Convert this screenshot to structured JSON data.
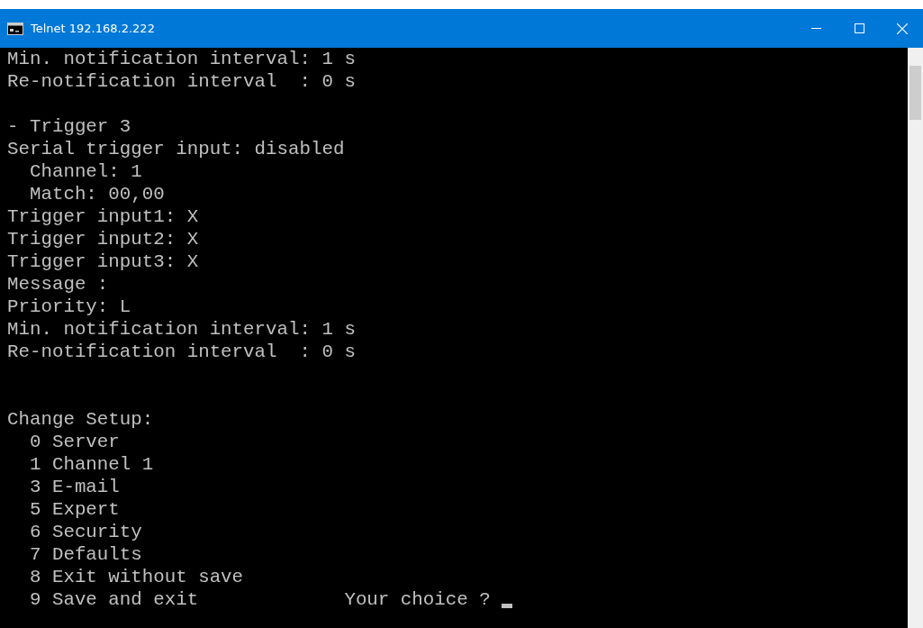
{
  "window": {
    "title": "Telnet 192.168.2.222"
  },
  "terminal": {
    "sections": [
      {
        "kind": "settings",
        "lines": [
          "Min. notification interval: 1 s",
          "Re-notification interval  : 0 s"
        ]
      },
      {
        "kind": "settings",
        "lines": [
          "- Trigger 3",
          "Serial trigger input: disabled",
          "  Channel: 1",
          "  Match: 00,00",
          "Trigger input1: X",
          "Trigger input2: X",
          "Trigger input3: X",
          "Message :",
          "Priority: L",
          "Min. notification interval: 1 s",
          "Re-notification interval  : 0 s"
        ]
      },
      {
        "kind": "menu",
        "title": "Change Setup:",
        "items": [
          "  0 Server",
          "  1 Channel 1",
          "  3 E-mail",
          "  5 Expert",
          "  6 Security",
          "  7 Defaults",
          "  8 Exit without save",
          "  9 Save and exit"
        ],
        "prompt": "Your choice ?"
      }
    ]
  }
}
